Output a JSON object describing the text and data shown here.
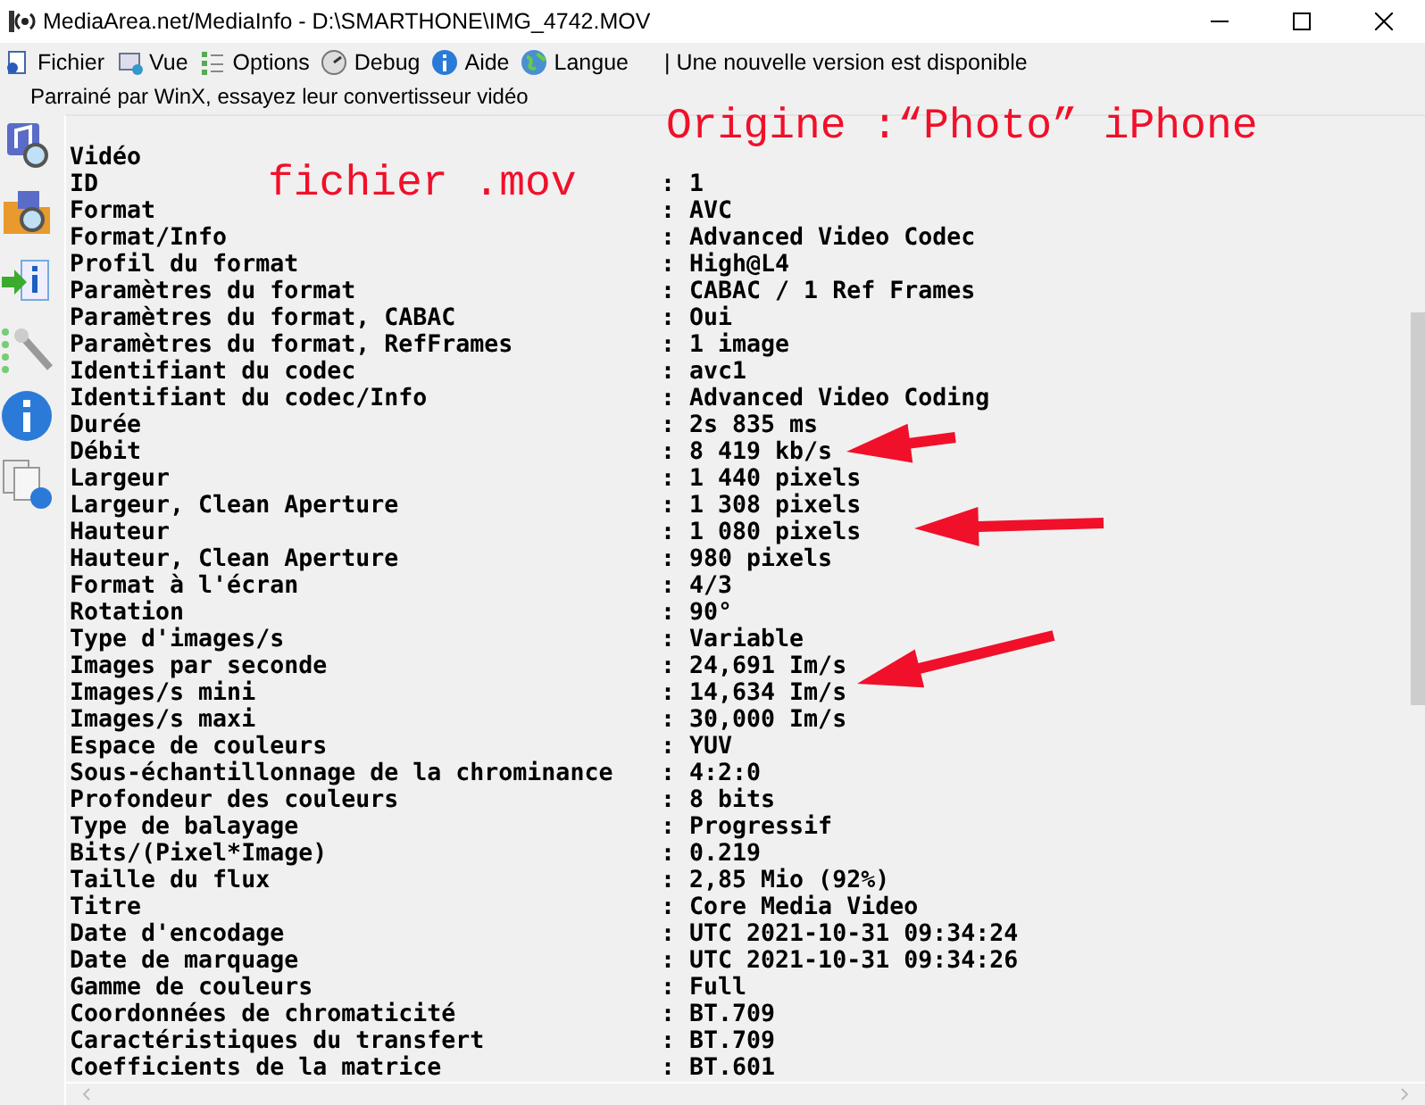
{
  "window": {
    "title": "MediaArea.net/MediaInfo - D:\\SMARTHONE\\IMG_4742.MOV"
  },
  "menu": [
    {
      "label": "Fichier"
    },
    {
      "label": "Vue"
    },
    {
      "label": "Options"
    },
    {
      "label": "Debug"
    },
    {
      "label": "Aide"
    },
    {
      "label": "Langue"
    }
  ],
  "notice": "| Une nouvelle version est disponible",
  "sponsor": "Parrainé par WinX, essayez leur convertisseur vidéo",
  "sidebar": [
    {
      "kind": "music"
    },
    {
      "kind": "folder"
    },
    {
      "kind": "import"
    },
    {
      "kind": "tools"
    },
    {
      "kind": "info"
    },
    {
      "kind": "pages"
    }
  ],
  "section": "Vidéo",
  "rows": [
    {
      "label": "ID",
      "colon": ":",
      "value": "1"
    },
    {
      "label": "Format",
      "colon": ":",
      "value": "AVC"
    },
    {
      "label": "Format/Info",
      "colon": ":",
      "value": "Advanced Video Codec"
    },
    {
      "label": "Profil du format",
      "colon": ":",
      "value": "High@L4"
    },
    {
      "label": "Paramètres du format",
      "colon": ":",
      "value": "CABAC / 1 Ref Frames"
    },
    {
      "label": "Paramètres du format, CABAC",
      "colon": ":",
      "value": "Oui"
    },
    {
      "label": "Paramètres du format, RefFrames",
      "colon": ":",
      "value": "1 image"
    },
    {
      "label": "Identifiant du codec",
      "colon": ":",
      "value": "avc1"
    },
    {
      "label": "Identifiant du codec/Info",
      "colon": ":",
      "value": "Advanced Video Coding"
    },
    {
      "label": "Durée",
      "colon": ":",
      "value": "2s 835 ms"
    },
    {
      "label": "Débit",
      "colon": ":",
      "value": "8 419 kb/s"
    },
    {
      "label": "Largeur",
      "colon": ":",
      "value": "1 440 pixels"
    },
    {
      "label": "Largeur, Clean Aperture",
      "colon": ":",
      "value": "1 308 pixels"
    },
    {
      "label": "Hauteur",
      "colon": ":",
      "value": "1 080 pixels"
    },
    {
      "label": "Hauteur, Clean Aperture",
      "colon": ":",
      "value": "980 pixels"
    },
    {
      "label": "Format à l'écran",
      "colon": ":",
      "value": "4/3"
    },
    {
      "label": "Rotation",
      "colon": ":",
      "value": "90°"
    },
    {
      "label": "Type d'images/s",
      "colon": ":",
      "value": "Variable"
    },
    {
      "label": "Images par seconde",
      "colon": ":",
      "value": "24,691 Im/s"
    },
    {
      "label": "Images/s mini",
      "colon": ":",
      "value": "14,634 Im/s"
    },
    {
      "label": "Images/s maxi",
      "colon": ":",
      "value": "30,000 Im/s"
    },
    {
      "label": "Espace de couleurs",
      "colon": ":",
      "value": "YUV"
    },
    {
      "label": "Sous-échantillonnage de la chrominance",
      "colon": ":",
      "value": "4:2:0"
    },
    {
      "label": "Profondeur des couleurs",
      "colon": ":",
      "value": "8 bits"
    },
    {
      "label": "Type de balayage",
      "colon": ":",
      "value": "Progressif"
    },
    {
      "label": "Bits/(Pixel*Image)",
      "colon": ":",
      "value": "0.219"
    },
    {
      "label": "Taille du flux",
      "colon": ":",
      "value": "2,85 Mio (92%)"
    },
    {
      "label": "Titre",
      "colon": ":",
      "value": "Core Media Video"
    },
    {
      "label": "Date d'encodage",
      "colon": ":",
      "value": "UTC 2021-10-31 09:34:24"
    },
    {
      "label": "Date de marquage",
      "colon": ":",
      "value": "UTC 2021-10-31 09:34:26"
    },
    {
      "label": "Gamme de couleurs",
      "colon": ":",
      "value": "Full"
    },
    {
      "label": "Coordonnées de chromaticité",
      "colon": ":",
      "value": "BT.709"
    },
    {
      "label": "Caractéristiques du transfert",
      "colon": ":",
      "value": "BT.709"
    },
    {
      "label": "Coefficients de la matrice",
      "colon": ":",
      "value": "BT.601"
    }
  ],
  "annotations": [
    {
      "kind": "text",
      "text": "Origine :“Photo” iPhone"
    },
    {
      "kind": "text",
      "text": "fichier .mov"
    },
    {
      "kind": "arrow"
    },
    {
      "kind": "arrow"
    },
    {
      "kind": "arrow"
    }
  ]
}
